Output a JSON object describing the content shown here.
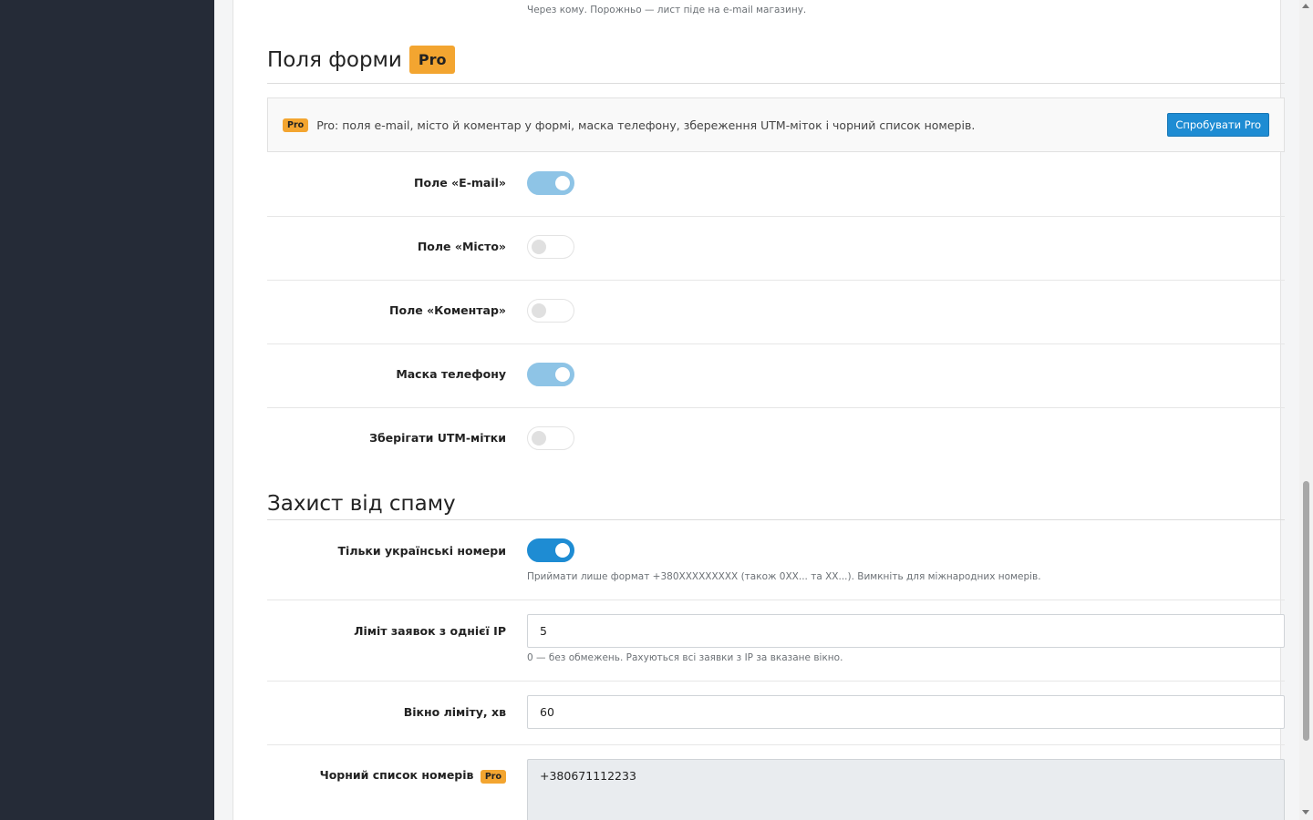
{
  "top_help": "Через кому. Порожньо — лист піде на e-mail магазину.",
  "form_fields": {
    "title": "Поля форми",
    "badge": "Pro",
    "notice": {
      "badge": "Pro",
      "text": "Pro: поля e-mail, місто й коментар у формі, маска телефону, збереження UTM-міток і чорний список номерів.",
      "button": "Спробувати Pro"
    },
    "rows": [
      {
        "label": "Поле «E-mail»",
        "enabled": true
      },
      {
        "label": "Поле «Місто»",
        "enabled": false
      },
      {
        "label": "Поле «Коментар»",
        "enabled": false
      },
      {
        "label": "Маска телефону",
        "enabled": true
      },
      {
        "label": "Зберігати UTM-мітки",
        "enabled": false
      }
    ]
  },
  "spam": {
    "title": "Захист від спаму",
    "ua_only": {
      "label": "Тільки українські номери",
      "enabled": true,
      "help": "Приймати лише формат +380XXXXXXXXX (також 0XX... та XX...). Вимкніть для міжнародних номерів."
    },
    "ip_limit": {
      "label": "Ліміт заявок з однієї IP",
      "value": "5",
      "help": "0 — без обмежень. Рахуються всі заявки з IP за вказане вікно."
    },
    "window": {
      "label": "Вікно ліміту, хв",
      "value": "60"
    },
    "blacklist": {
      "label": "Чорний список номерів",
      "badge": "Pro",
      "value": "+380671112233"
    }
  },
  "colors": {
    "accent": "#1e8cd3",
    "pro_badge": "#f3a530",
    "sidebar": "#252b37"
  }
}
